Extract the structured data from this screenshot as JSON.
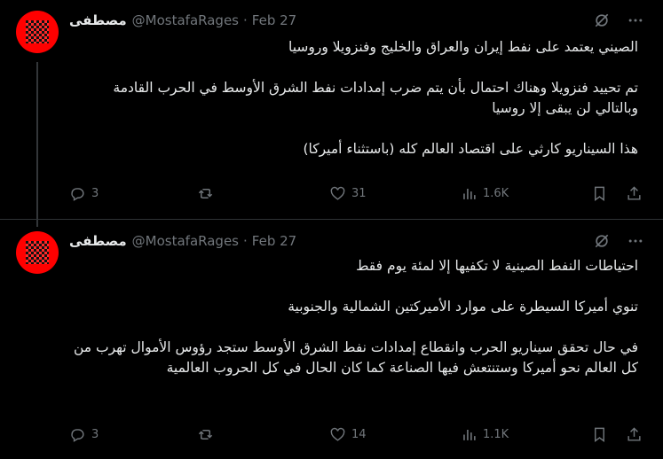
{
  "tweets": [
    {
      "name": "مصطفى",
      "handle": "@MostafaRages",
      "separator": "·",
      "date": "Feb 27",
      "paragraphs": [
        "الصيني يعتمد على نفط إيران والعراق والخليج وفنزويلا وروسيا",
        "تم تحييد فنزويلا وهناك احتمال بأن يتم ضرب إمدادات نفط الشرق الأوسط في الحرب القادمة وبالتالي لن يبقى إلا روسيا",
        "هذا السيناريو كارثي على اقتصاد العالم كله (باستثناء أميركا)"
      ],
      "replies": "3",
      "retweets": "",
      "likes": "31",
      "views": "1.6K"
    },
    {
      "name": "مصطفى",
      "handle": "@MostafaRages",
      "separator": "·",
      "date": "Feb 27",
      "paragraphs": [
        "احتياطات النفط الصينية لا تكفيها إلا لمئة يوم فقط",
        "تنوي أميركا السيطرة على موارد الأميركتين الشمالية والجنوبية",
        "في حال تحقق سيناريو الحرب وانقطاع إمدادات نفط الشرق الأوسط ستجد رؤوس الأموال تهرب من كل العالم نحو أميركا وستنتعش فيها الصناعة كما كان الحال في كل الحروب العالمية"
      ],
      "replies": "3",
      "retweets": "",
      "likes": "14",
      "views": "1.1K"
    }
  ],
  "icons": {
    "grok": "grok-icon",
    "more": "more-icon",
    "reply": "reply-icon",
    "retweet": "retweet-icon",
    "like": "heart-icon",
    "views": "views-icon",
    "bookmark": "bookmark-icon",
    "share": "share-icon"
  },
  "colors": {
    "background": "#000000",
    "text": "#e7e9ea",
    "muted": "#71767b",
    "divider": "#2f3336",
    "avatar": "#ff0000"
  }
}
